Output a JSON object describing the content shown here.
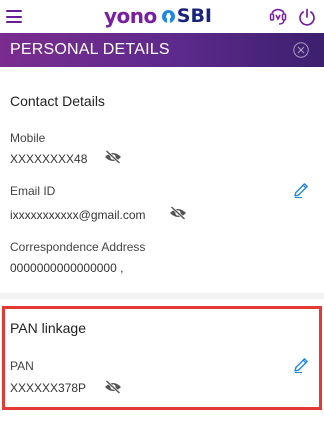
{
  "app": {
    "logo_left": "yono",
    "logo_right": "SBI"
  },
  "header": {
    "title": "PERSONAL DETAILS"
  },
  "contact": {
    "title": "Contact Details",
    "mobile_label": "Mobile",
    "mobile_value": "XXXXXXXX48",
    "email_label": "Email ID",
    "email_value": "ixxxxxxxxxxx@gmail.com",
    "address_label": "Correspondence Address",
    "address_value": "0000000000000000 ,"
  },
  "pan": {
    "title": "PAN linkage",
    "label": "PAN",
    "value": "XXXXXX378P"
  },
  "colors": {
    "accent": "#7b1fa2",
    "header_gradient_start": "#7a2c8f",
    "header_gradient_end": "#3c1f6e",
    "highlight_border": "#e53935",
    "edit_icon": "#1e88e5"
  },
  "icons": [
    "menu-icon",
    "assistant-icon",
    "power-icon",
    "close-icon",
    "eye-off-icon",
    "pencil-icon"
  ]
}
